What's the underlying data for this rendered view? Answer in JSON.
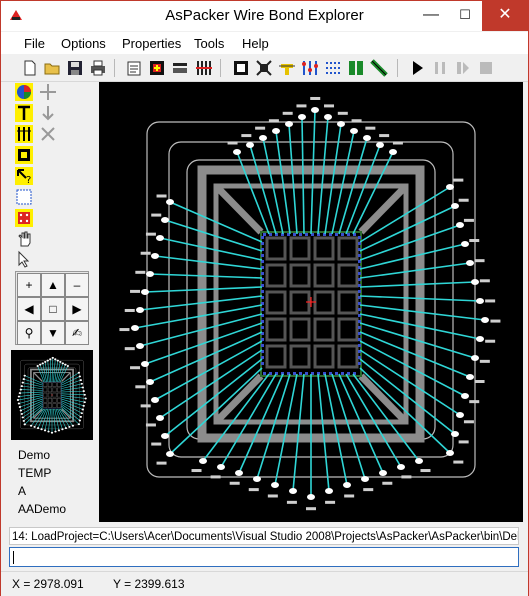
{
  "window": {
    "title": "AsPacker Wire Bond Explorer",
    "close_color": "#c0392b"
  },
  "menu": [
    "File",
    "Options",
    "Properties",
    "Tools",
    "Help"
  ],
  "projects": [
    "Demo",
    "TEMP",
    "A",
    "AADemo"
  ],
  "command_log": "14: LoadProject=C:\\Users\\Acer\\Documents\\Visual Studio 2008\\Projects\\AsPacker\\AsPacker\\bin\\Deb",
  "command_input": "",
  "status": {
    "x_text": "X = 2978.091",
    "y_text": "Y = 2399.613"
  },
  "colors": {
    "wire": "#2fd6d6",
    "frame": "#8c8c8c",
    "die": "#3a3a3a",
    "pad": "#3a4fd0",
    "bondball": "#ffffff",
    "cursor": "#ff2020"
  },
  "icons": {
    "toolbar": [
      "new-file-icon",
      "open-folder-icon",
      "save-icon",
      "print-icon",
      "properties-icon",
      "add-die-icon",
      "substrate-icon",
      "bond-fingers-icon",
      "select-box-icon",
      "die-attach-icon",
      "wire-tool-icon",
      "align-icon",
      "grid-icon",
      "layers-icon",
      "route-icon",
      "play-icon",
      "pause-icon",
      "step-icon",
      "stop-icon"
    ],
    "left": [
      "color-wheel-icon",
      "move-icon",
      "text-tool-icon",
      "move-down-icon",
      "bars-tool-icon",
      "delete-icon",
      "chip-tool-icon",
      "hint-tool-icon",
      "select-region-icon",
      "select-pads-icon",
      "hand-icon",
      "pointer-icon"
    ]
  }
}
